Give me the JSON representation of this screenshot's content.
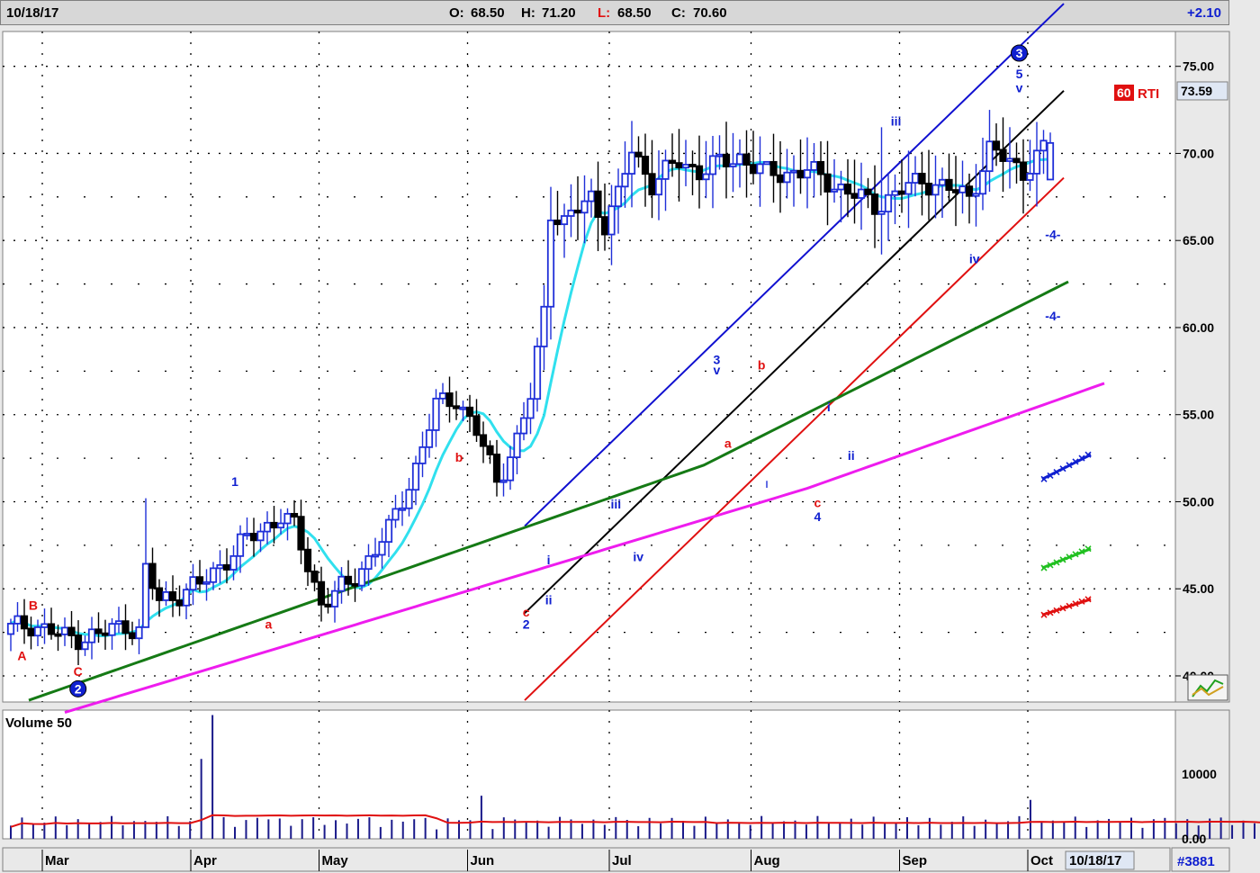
{
  "header": {
    "date": "10/18/17",
    "open_label": "O:",
    "open_value": "68.50",
    "high_label": "H:",
    "high_value": "71.20",
    "low_label": "L:",
    "low_value": "68.50",
    "close_label": "C:",
    "close_value": "70.60",
    "change": "+2.10"
  },
  "colors": {
    "candle_up": "#1f2fd8",
    "candle_down": "#000000",
    "ma_fast": "#30e0ee",
    "ma_mid": "#157a15",
    "ma_slow": "#ee1cee",
    "channel_top": "#1010d0",
    "channel_mid": "#000000",
    "channel_bottom": "#e01010",
    "volume_bar": "#1a1a8a",
    "volume_avg": "#e01010",
    "price_box": "#dfe7f4"
  },
  "chart_data": {
    "type": "candlestick",
    "price_axis": {
      "ylim": [
        38.5,
        77.0
      ],
      "ticks": [
        "75.00",
        "70.00",
        "65.00",
        "60.00",
        "55.00",
        "50.00",
        "45.00",
        "40.00"
      ],
      "tick_values": [
        75,
        70,
        65,
        60,
        55,
        50,
        45,
        40
      ],
      "last_price": "73.59",
      "last_price_value": 73.59
    },
    "months": [
      {
        "label": "Mar",
        "index": 0
      },
      {
        "label": "Apr",
        "index": 22
      },
      {
        "label": "May",
        "index": 41
      },
      {
        "label": "Jun",
        "index": 63
      },
      {
        "label": "Jul",
        "index": 84
      },
      {
        "label": "Aug",
        "index": 105
      },
      {
        "label": "Sep",
        "index": 127
      },
      {
        "label": "Oct",
        "index": 146
      }
    ],
    "date_box": "10/18/17",
    "counter": "#3881",
    "volume_panel": {
      "title": "Volume 50",
      "ticks": [
        "10000",
        "0.00"
      ],
      "tick_values": [
        10000,
        0
      ],
      "ylim": [
        0,
        18000
      ]
    },
    "key_candles": [
      {
        "index": 20,
        "high": 50.2,
        "low": 45.2
      },
      {
        "index": 112,
        "high": 51.2,
        "low": 50.8
      },
      {
        "index": 129,
        "high": 71.5,
        "low": 64.2
      },
      {
        "index": 145,
        "high": 72.5,
        "low": 67.8
      },
      {
        "index": 154,
        "open": 68.5,
        "high": 71.2,
        "low": 68.5,
        "close": 70.6
      }
    ],
    "rti_label": {
      "number": "60",
      "text": "RTI"
    },
    "wave_labels": [
      {
        "text": "A",
        "i": 1,
        "price": 40.9,
        "color": "red"
      },
      {
        "text": "B",
        "i": 2,
        "price": 43.8,
        "color": "red"
      },
      {
        "text": "C",
        "i": 6,
        "price": 40.0,
        "color": "red"
      },
      {
        "text": "2",
        "i": 6,
        "price": 39.0,
        "color": "blue",
        "circle": true
      },
      {
        "text": "1",
        "i": 20,
        "price": 50.9,
        "color": "blue"
      },
      {
        "text": "a",
        "i": 23,
        "price": 42.7,
        "color": "red"
      },
      {
        "text": "b",
        "i": 40,
        "price": 52.3,
        "color": "red"
      },
      {
        "text": "c",
        "i": 46,
        "price": 43.4,
        "color": "red"
      },
      {
        "text": "2",
        "i": 46,
        "price": 42.7,
        "color": "blue"
      },
      {
        "text": "i",
        "i": 48,
        "price": 46.4,
        "color": "blue"
      },
      {
        "text": "ii",
        "i": 48,
        "price": 44.1,
        "color": "blue"
      },
      {
        "text": "iii",
        "i": 54,
        "price": 49.6,
        "color": "blue"
      },
      {
        "text": "iv",
        "i": 56,
        "price": 46.6,
        "color": "blue"
      },
      {
        "text": "3",
        "i": 63,
        "price": 57.9,
        "color": "blue"
      },
      {
        "text": "v",
        "i": 63,
        "price": 57.3,
        "color": "blue"
      },
      {
        "text": "a",
        "i": 64,
        "price": 53.1,
        "color": "red"
      },
      {
        "text": "b",
        "i": 67,
        "price": 57.6,
        "color": "red"
      },
      {
        "text": "i",
        "i": 73,
        "price": 55.2,
        "color": "blue"
      },
      {
        "text": "c",
        "i": 72,
        "price": 49.7,
        "color": "red"
      },
      {
        "text": "4",
        "i": 72,
        "price": 48.9,
        "color": "blue"
      },
      {
        "text": "ii",
        "i": 75,
        "price": 52.4,
        "color": "blue"
      },
      {
        "text": "iii",
        "i": 79,
        "price": 71.6,
        "color": "blue"
      },
      {
        "text": "iv",
        "i": 86,
        "price": 63.7,
        "color": "blue"
      },
      {
        "text": "3",
        "i": 90,
        "price": 75.5,
        "color": "blue",
        "circle": true
      },
      {
        "text": "5",
        "i": 90,
        "price": 74.3,
        "color": "blue"
      },
      {
        "text": "v",
        "i": 90,
        "price": 73.5,
        "color": "blue"
      },
      {
        "text": "-4-",
        "i": 93,
        "price": 65.1,
        "color": "blue"
      },
      {
        "text": "-4-",
        "i": 93,
        "price": 60.4,
        "color": "blue"
      }
    ]
  }
}
